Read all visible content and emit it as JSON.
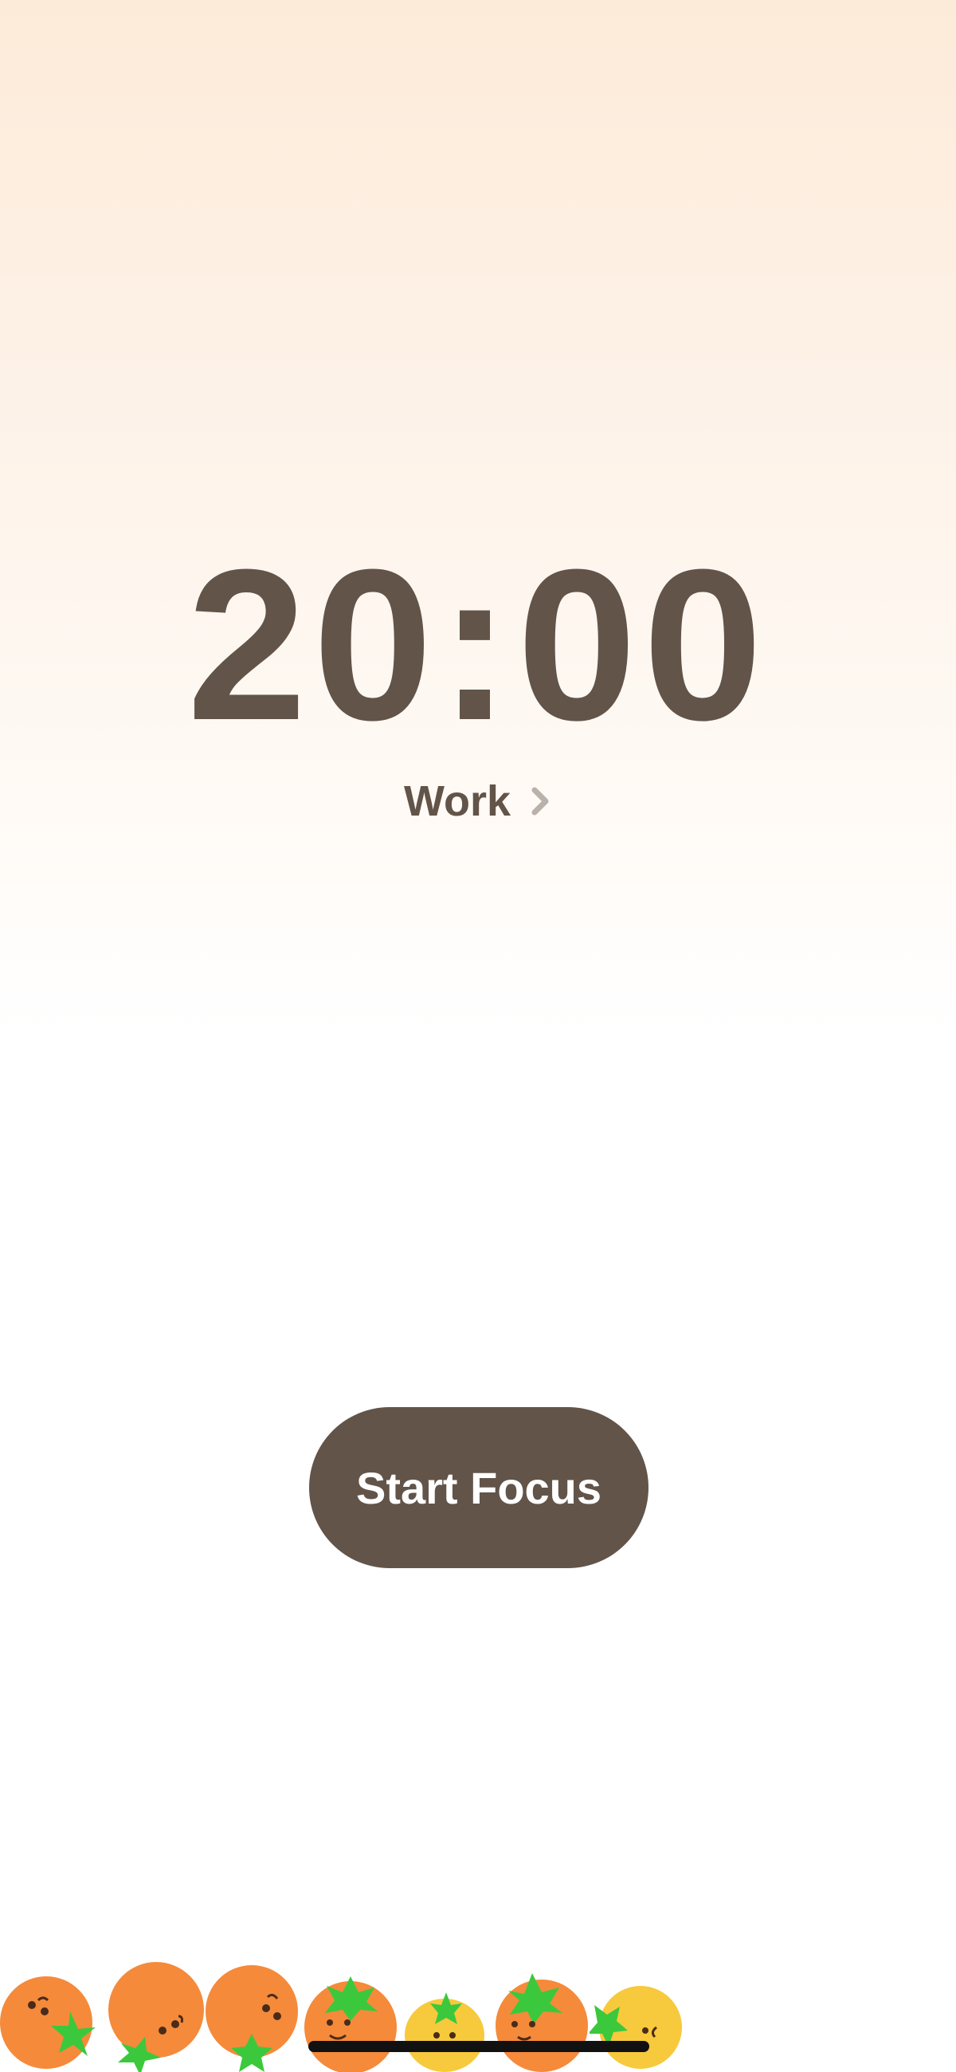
{
  "timer": {
    "display": "20:00"
  },
  "mode": {
    "label": "Work",
    "chevron_icon": "chevron-right-icon"
  },
  "actions": {
    "start_label": "Start Focus"
  },
  "decoration": {
    "tomatoes": [
      {
        "color": "#f58a3a",
        "kind": "orange-tomato"
      },
      {
        "color": "#f58a3a",
        "kind": "orange-tomato"
      },
      {
        "color": "#f58a3a",
        "kind": "orange-tomato"
      },
      {
        "color": "#f58a3a",
        "kind": "orange-tomato"
      },
      {
        "color": "#f7c93c",
        "kind": "yellow-tomato"
      },
      {
        "color": "#f58a3a",
        "kind": "orange-tomato"
      },
      {
        "color": "#f7c93c",
        "kind": "yellow-tomato"
      }
    ],
    "stem_color": "#3cc83c"
  },
  "colors": {
    "primary_text": "#625449",
    "button_background": "#625449",
    "button_text": "#ffffff",
    "chevron": "#b9b1aa",
    "background_top": "#fdebd9",
    "background_bottom": "#ffffff"
  }
}
